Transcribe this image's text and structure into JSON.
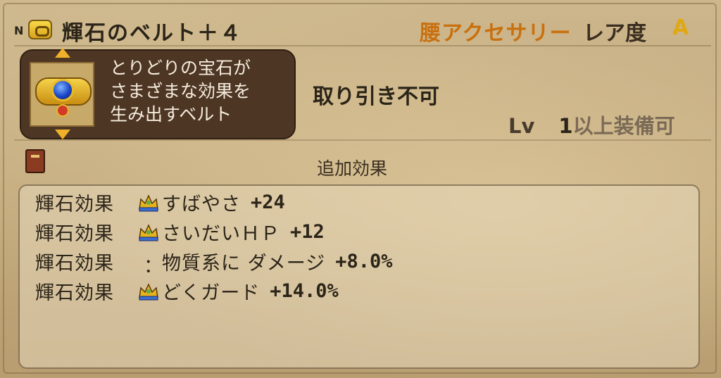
{
  "header": {
    "rank_marker": "N",
    "item_name": "輝石のベルト＋４",
    "category": "腰アクセサリー",
    "rarity_label": "レア度",
    "rarity_value": "A"
  },
  "description": {
    "lines": [
      "とりどりの宝石が",
      "さまざまな効果を",
      "生み出すベルト"
    ]
  },
  "trade_status": "取り引き不可",
  "level": {
    "prefix": "Lv",
    "value": "1",
    "suffix": "以上装備可"
  },
  "extra_effects_label": "追加効果",
  "effects": [
    {
      "label": "輝石効果",
      "icon": "crown-icon",
      "text": "すばやさ",
      "value": "+24"
    },
    {
      "label": "輝石効果",
      "icon": "crown-icon",
      "text": "さいだいＨＰ",
      "value": "+12"
    },
    {
      "label": "輝石効果",
      "icon": "colon",
      "text": "物質系に ダメージ",
      "value": "+8.0%"
    },
    {
      "label": "輝石効果",
      "icon": "crown-icon",
      "text": "どくガード",
      "value": "+14.0%"
    }
  ],
  "colors": {
    "category": "#c9700e",
    "rarity": "#e0a812",
    "panel": "#4e3625"
  }
}
